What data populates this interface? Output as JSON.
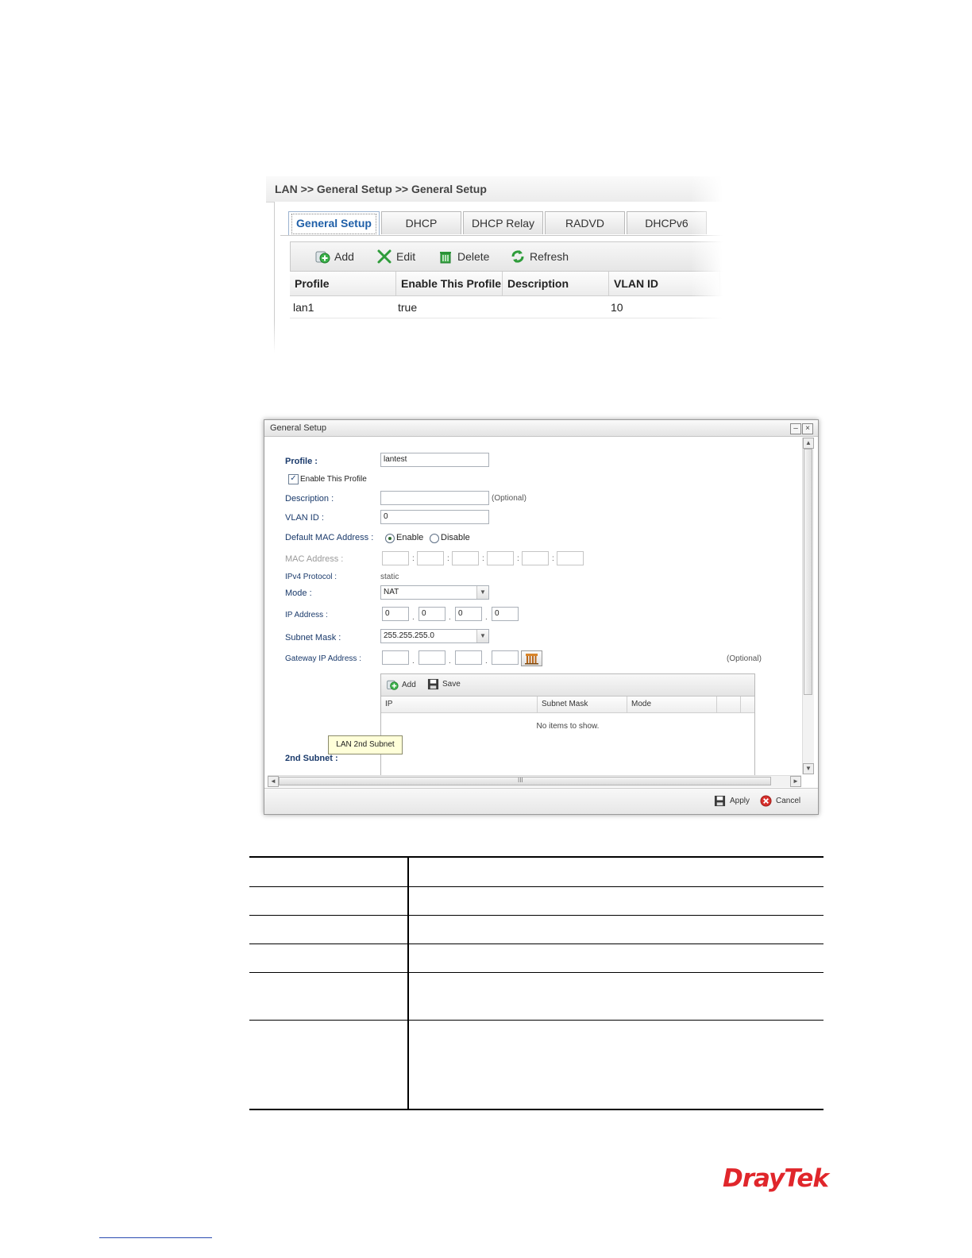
{
  "screenshot1": {
    "breadcrumb": "LAN >> General Setup >> General Setup",
    "tabs": [
      "General Setup",
      "DHCP",
      "DHCP Relay",
      "RADVD",
      "DHCPv6"
    ],
    "active_tab": "General Setup",
    "toolbar": {
      "add": "Add",
      "edit": "Edit",
      "delete": "Delete",
      "refresh": "Refresh"
    },
    "columns": [
      "Profile",
      "Enable This Profile",
      "Description",
      "VLAN ID"
    ],
    "rows": [
      {
        "profile": "lan1",
        "enabled": "true",
        "description": "",
        "vlan_id": "10"
      }
    ]
  },
  "dialog": {
    "title": "General Setup",
    "profile_label": "Profile :",
    "profile_value": "lantest",
    "enable_label": "Enable This Profile",
    "enable_checked": true,
    "description_label": "Description :",
    "description_value": "",
    "optional": "(Optional)",
    "vlan_label": "VLAN ID :",
    "vlan_value": "0",
    "default_mac_label": "Default MAC Address :",
    "enable_opt": "Enable",
    "disable_opt": "Disable",
    "mac_label": "MAC Address :",
    "ipv4_label": "IPv4 Protocol :",
    "ipv4_value": "static",
    "mode_label": "Mode :",
    "mode_value": "NAT",
    "ip_label": "IP Address :",
    "ip_values": [
      "0",
      "0",
      "0",
      "0"
    ],
    "subnet_label": "Subnet Mask :",
    "subnet_value": "255.255.255.0",
    "gateway_label": "Gateway IP Address :",
    "gateway_optional": "(Optional)",
    "sub_toolbar": {
      "add": "Add",
      "save": "Save"
    },
    "sub_columns": [
      "IP",
      "Subnet Mask",
      "Mode"
    ],
    "empty_text": "No items to show.",
    "tooltip": "LAN 2nd Subnet",
    "second_subnet_label": "2nd Subnet :",
    "apply": "Apply",
    "cancel": "Cancel",
    "scroll_mark": "III"
  },
  "footer": {
    "logo": "DrayTek"
  }
}
